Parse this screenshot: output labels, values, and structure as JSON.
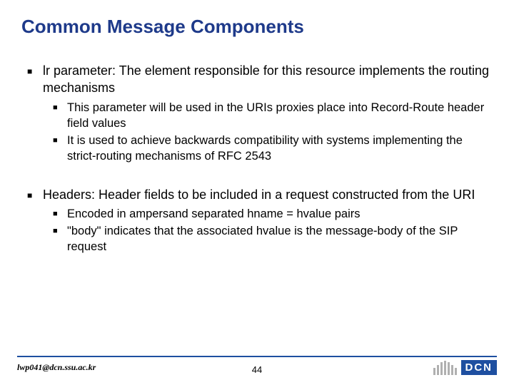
{
  "title": "Common Message Components",
  "sections": [
    {
      "heading": "lr parameter: The element responsible for this resource implements the routing mechanisms",
      "items": [
        "This parameter will be used in the URIs proxies place into Record-Route header field values",
        "It is used to achieve backwards compatibility with systems implementing the strict-routing mechanisms of RFC 2543"
      ]
    },
    {
      "heading": "Headers: Header fields to be included in a request constructed from the URI",
      "items": [
        "Encoded in ampersand separated hname = hvalue pairs",
        "\"body\" indicates that the associated hvalue is the message-body of the SIP request"
      ]
    }
  ],
  "footer": {
    "email": "lwp041@dcn.ssu.ac.kr",
    "page": "44",
    "logo": "DCN"
  }
}
